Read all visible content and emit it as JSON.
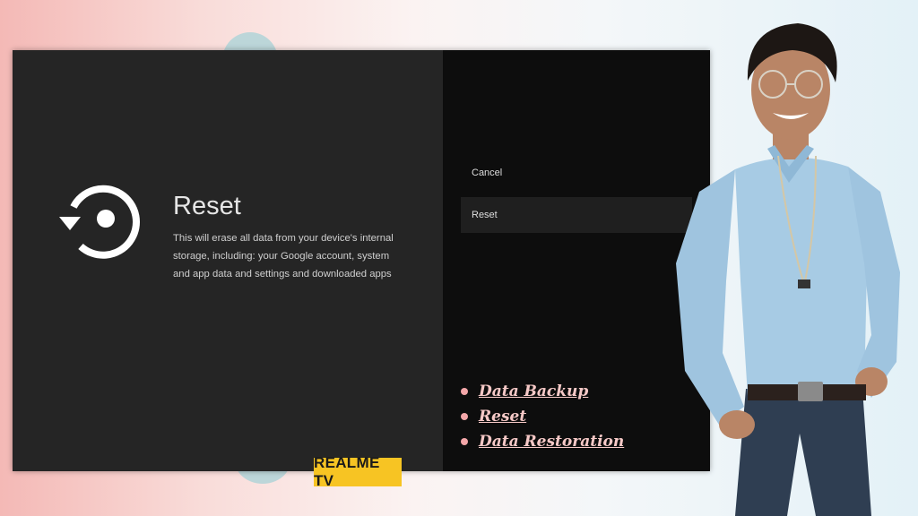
{
  "reset_screen": {
    "title": "Reset",
    "description": "This will erase all data from your device's internal storage, including: your Google account, system and app data and settings and downloaded apps",
    "icon": "reset-icon"
  },
  "menu": {
    "options": [
      {
        "label": "Cancel"
      },
      {
        "label": "Reset",
        "selected": true
      }
    ]
  },
  "links": [
    {
      "label": "Data Backup"
    },
    {
      "label": "Reset"
    },
    {
      "label": "Data Restoration"
    }
  ],
  "brand_label": "REALME TV",
  "colors": {
    "left_panel": "#252525",
    "right_panel": "#0d0d0d",
    "selected_item": "#1f1f1f",
    "badge": "#f7c423",
    "link": "#f6c9c7",
    "bullet": "#f4a7a9"
  }
}
